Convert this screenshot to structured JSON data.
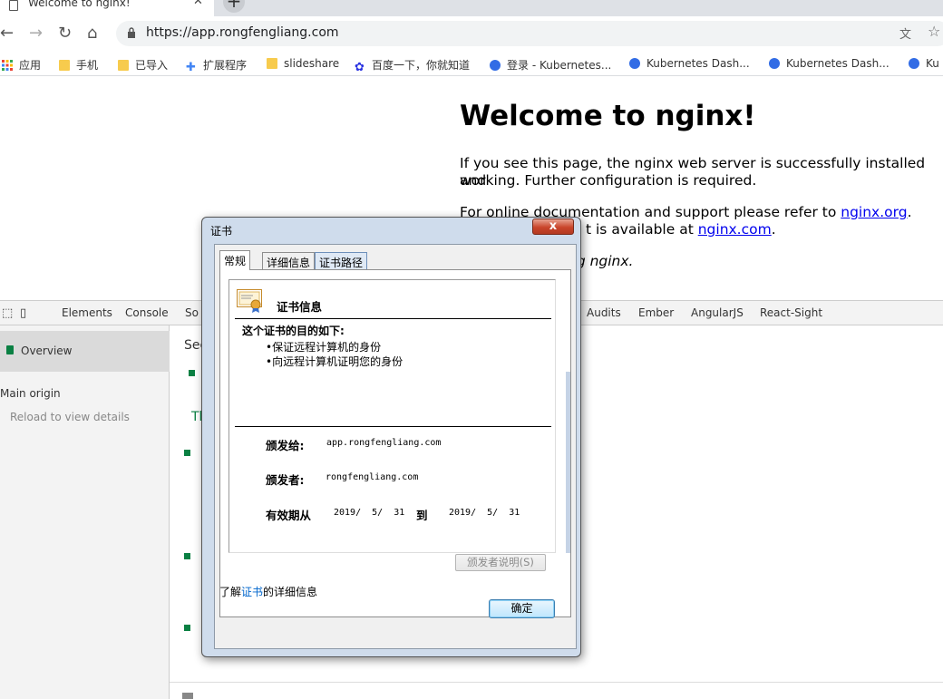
{
  "browser": {
    "tab_title": "Welcome to nginx!",
    "url": "https://app.rongfengliang.com",
    "bookmarks": [
      "应用",
      "手机",
      "已导入",
      "扩展程序",
      "slideshare",
      "百度一下，你就知道",
      "登录 - Kubernetes...",
      "Kubernetes Dash...",
      "Kubernetes Dash...",
      "Ku"
    ]
  },
  "page": {
    "heading": "Welcome to nginx!",
    "para1_line1": "If you see this page, the nginx web server is successfully installed and",
    "para1_line2": "working. Further configuration is required.",
    "para2_prefix": "For online documentation and support please refer to ",
    "link_org": "nginx.org",
    "para2_dot": ".",
    "para2_line2_prefix": "t is available at ",
    "link_com": "nginx.com",
    "para3_fragment": "ng nginx."
  },
  "devtools": {
    "tabs": [
      "Elements",
      "Console",
      "So",
      "Audits",
      "Ember",
      "AngularJS",
      "React-Sight"
    ],
    "overview": "Overview",
    "main_origin": "Main origin",
    "reload": "Reload to view details",
    "main_title_fragment": "Sec",
    "main_text_fragment": "Th"
  },
  "dialog": {
    "title": "证书",
    "close": "x",
    "tabs": [
      "常规",
      "详细信息",
      "证书路径"
    ],
    "heading": "证书信息",
    "purpose_title": "这个证书的目的如下:",
    "purposes": [
      "•保证远程计算机的身份",
      "•向远程计算机证明您的身份"
    ],
    "issued_to_label": "颁发给:",
    "issued_to": "app.rongfengliang.com",
    "issued_by_label": "颁发者:",
    "issued_by": "rongfengliang.com",
    "valid_label": "有效期从",
    "valid_from": "2019/  5/  31",
    "valid_to_label": "到",
    "valid_to": "2019/  5/  31",
    "issuer_statement": "颁发者说明(S)",
    "learn_prefix": "了解",
    "learn_link": "证书",
    "learn_suffix": "的详细信息",
    "ok": "确定"
  }
}
